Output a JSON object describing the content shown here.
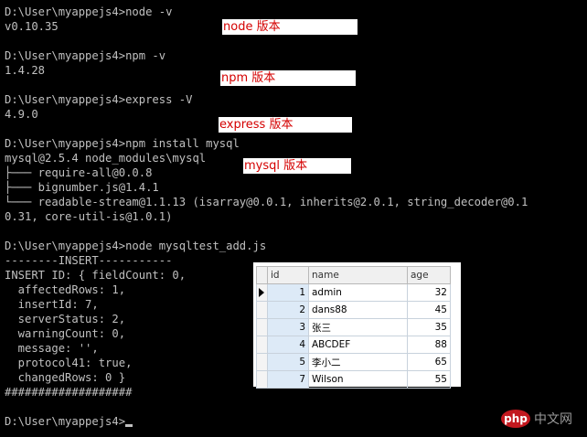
{
  "console": {
    "lines": [
      "D:\\User\\myappejs4>node -v",
      "v0.10.35",
      "",
      "D:\\User\\myappejs4>npm -v",
      "1.4.28",
      "",
      "D:\\User\\myappejs4>express -V",
      "4.9.0",
      "",
      "D:\\User\\myappejs4>npm install mysql",
      "mysql@2.5.4 node_modules\\mysql",
      "├─── require-all@0.0.8",
      "├─── bignumber.js@1.4.1",
      "└─── readable-stream@1.1.13 (isarray@0.0.1, inherits@2.0.1, string_decoder@0.1",
      "0.31, core-util-is@1.0.1)",
      "",
      "D:\\User\\myappejs4>node mysqltest_add.js",
      "--------INSERT-----------",
      "INSERT ID: { fieldCount: 0,",
      "  affectedRows: 1,",
      "  insertId: 7,",
      "  serverStatus: 2,",
      "  warningCount: 0,",
      "  message: '',",
      "  protocol41: true,",
      "  changedRows: 0 }",
      "###################",
      "",
      "D:\\User\\myappejs4>"
    ]
  },
  "annotations": {
    "node": "node 版本",
    "npm": "npm 版本",
    "express": "express 版本",
    "mysql": "mysql 版本"
  },
  "grid": {
    "headers": {
      "id": "id",
      "name": "name",
      "age": "age"
    },
    "rows": [
      {
        "id": "1",
        "name": "admin",
        "age": "32"
      },
      {
        "id": "2",
        "name": "dans88",
        "age": "45"
      },
      {
        "id": "3",
        "name": "张三",
        "age": "35"
      },
      {
        "id": "4",
        "name": "ABCDEF",
        "age": "88"
      },
      {
        "id": "5",
        "name": "李小二",
        "age": "65"
      },
      {
        "id": "7",
        "name": "Wilson",
        "age": "55"
      }
    ]
  },
  "watermark": {
    "logo": "php",
    "text": "中文网"
  },
  "colors": {
    "console_bg": "#000000",
    "console_text": "#c0c0c0",
    "annotation_text": "#d40000",
    "selected_cell": "#ddeaf7"
  }
}
